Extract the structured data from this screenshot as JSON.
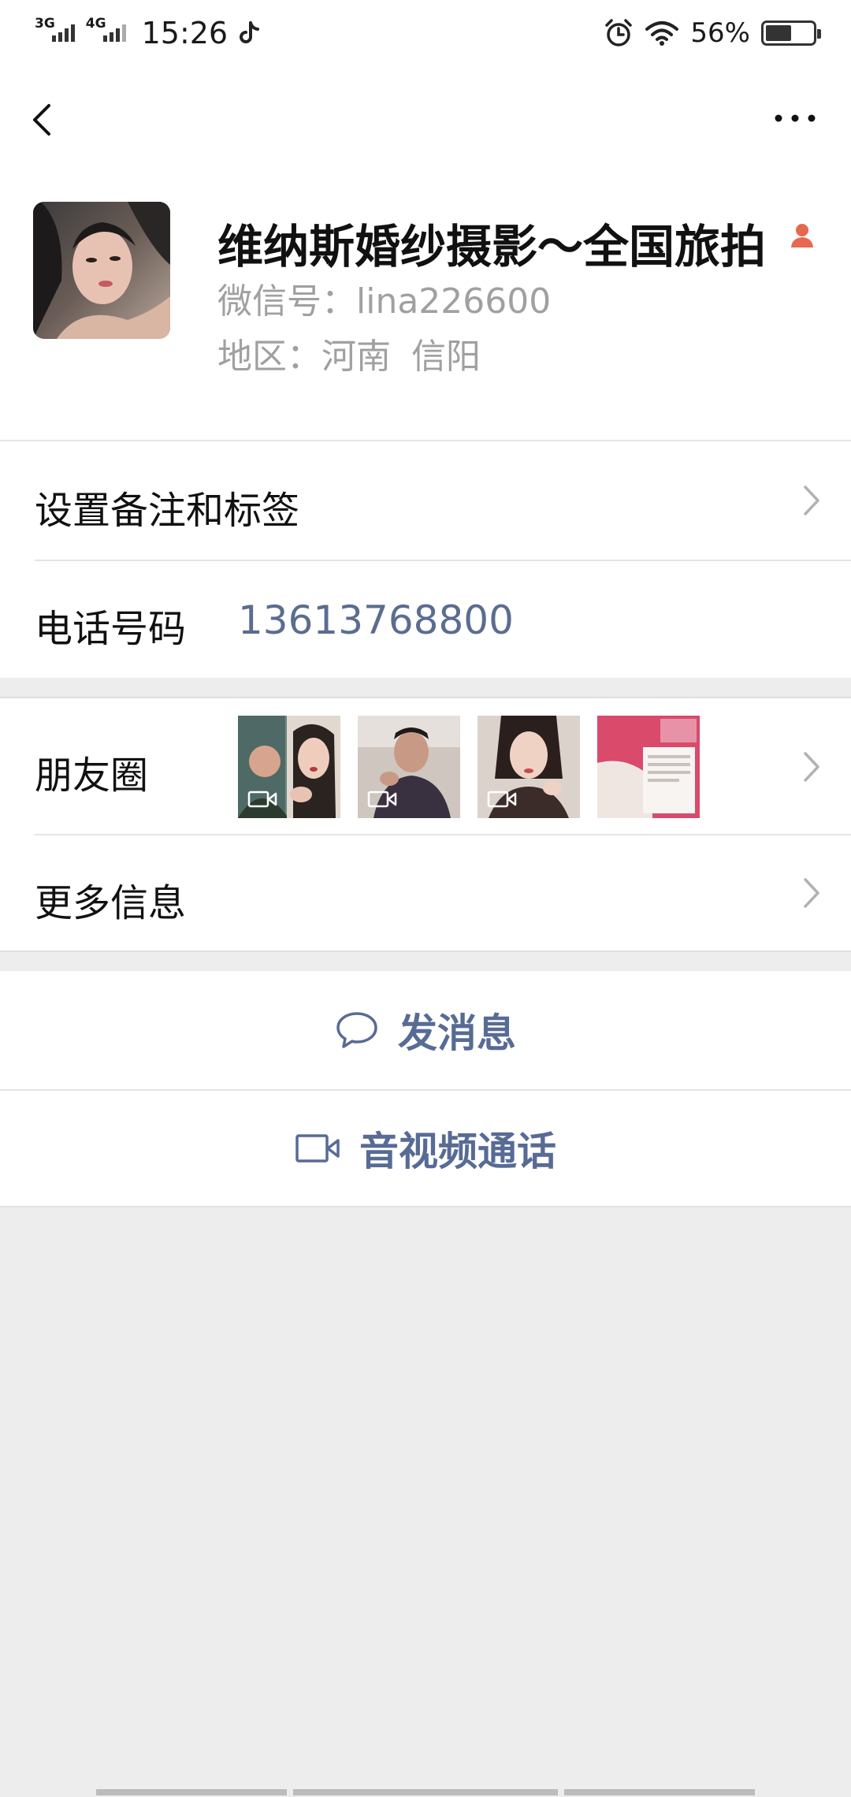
{
  "status_bar": {
    "net1": "3G",
    "net2": "4G",
    "time": "15:26",
    "battery": "56%",
    "battery_level": 0.56,
    "icons": [
      "tiktok-icon",
      "alarm-icon",
      "wifi-icon",
      "battery-icon"
    ]
  },
  "nav": {
    "back_icon": "chevron-left-icon",
    "more_icon": "more-dots-icon"
  },
  "profile": {
    "name": "维纳斯婚纱摄影～全国旅拍",
    "wechat_id": "微信号：lina226600",
    "region_label": "地区：河南",
    "region_city": "信阳",
    "gender_icon": "female-icon"
  },
  "cells": {
    "remark": "设置备注和标签",
    "phone_label": "电话号码",
    "phone_value": "13613768800",
    "moments": "朋友圈",
    "more_info": "更多信息"
  },
  "actions": {
    "message": "发消息",
    "call": "音视频通话"
  },
  "colors": {
    "link": "#576b95",
    "background": "#ededed",
    "female_icon": "#e8674f"
  }
}
